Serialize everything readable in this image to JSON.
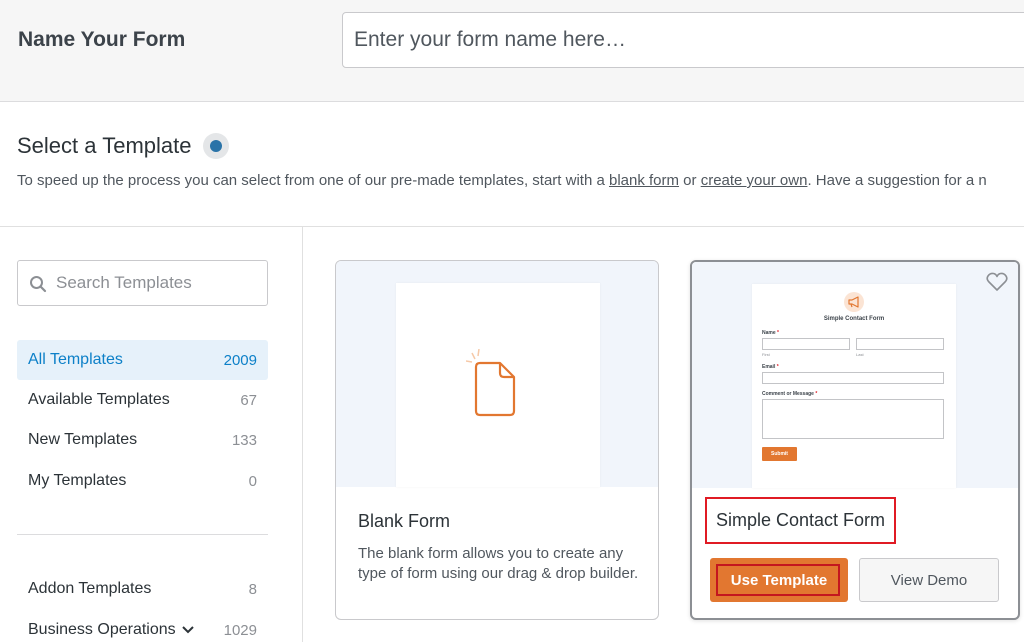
{
  "header": {
    "name_label": "Name Your Form",
    "name_placeholder": "Enter your form name here…"
  },
  "template_section": {
    "title": "Select a Template",
    "desc_before": "To speed up the process you can select from one of our pre-made templates, start with a ",
    "blank_link": "blank form",
    "desc_middle": " or ",
    "create_link": "create your own",
    "desc_after": ". Have a suggestion for a n",
    "accent_color": "#2a73a8"
  },
  "sidebar": {
    "search_placeholder": "Search Templates",
    "categories": [
      {
        "label": "All Templates",
        "count": "2009"
      },
      {
        "label": "Available Templates",
        "count": "67"
      },
      {
        "label": "New Templates",
        "count": "133"
      },
      {
        "label": "My Templates",
        "count": "0"
      },
      {
        "label": "Addon Templates",
        "count": "8"
      },
      {
        "label": "Business Operations",
        "count": "1029"
      }
    ],
    "active_color": "#0d80c8"
  },
  "cards": [
    {
      "title": "Blank Form",
      "description": "The blank form allows you to create any type of form using our drag & drop builder.",
      "icon": "file-icon"
    },
    {
      "title": "Simple Contact Form",
      "use_label": "Use Template",
      "demo_label": "View Demo",
      "icon": "heart-icon",
      "preview": {
        "title": "Simple Contact Form",
        "name_label": "Name",
        "first_label": "First",
        "last_label": "Last",
        "email_label": "Email",
        "comment_label": "Comment or Message",
        "required_mark": "*",
        "submit_label": "Submit"
      }
    }
  ],
  "colors": {
    "button_orange": "#e27730",
    "highlight_red": "#e01b24"
  }
}
